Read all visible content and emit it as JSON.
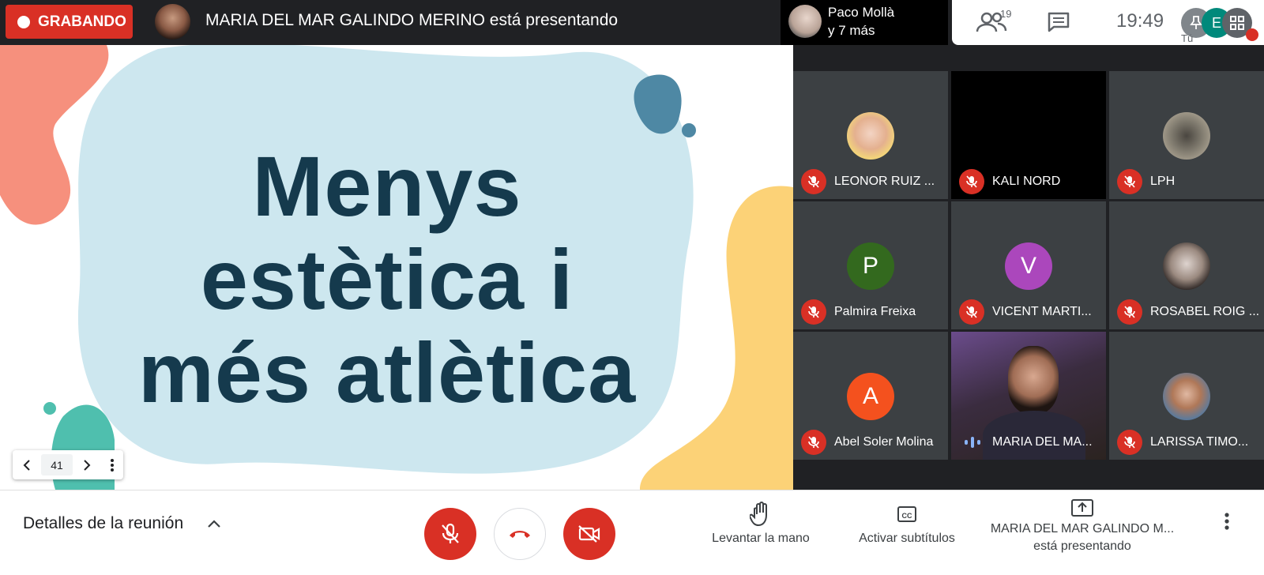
{
  "recording": {
    "label": "GRABANDO"
  },
  "presenter_bar": {
    "title": "MARIA DEL MAR GALINDO MERINO está presentando"
  },
  "others": {
    "line1": "Paco Mollà",
    "line2": "y 7 más"
  },
  "top_right": {
    "people_count": "19",
    "time": "19:49",
    "self_initial": "E",
    "self_label": "Tú"
  },
  "slide": {
    "lines": [
      "Menys",
      "estètica i",
      "més atlètica"
    ],
    "page": "41"
  },
  "participants": [
    {
      "name": "LEONOR RUIZ ...",
      "initial": "",
      "color": ""
    },
    {
      "name": "KALI NORD",
      "initial": "",
      "color": ""
    },
    {
      "name": "LPH",
      "initial": "",
      "color": ""
    },
    {
      "name": "Palmira Freixa",
      "initial": "P",
      "color": "#33691e"
    },
    {
      "name": "VICENT MARTI...",
      "initial": "V",
      "color": "#ab47bc"
    },
    {
      "name": "ROSABEL ROIG ...",
      "initial": "",
      "color": ""
    },
    {
      "name": "Abel Soler Molina",
      "initial": "A",
      "color": "#f4511e"
    },
    {
      "name": "MARIA DEL MA...",
      "initial": "",
      "color": ""
    },
    {
      "name": "LARISSA TIMO...",
      "initial": "",
      "color": ""
    }
  ],
  "bottom": {
    "details": "Detalles de la reunión",
    "raise_hand": "Levantar la mano",
    "captions": "Activar subtítulos",
    "presenting_name": "MARIA DEL MAR GALINDO M...",
    "presenting_status": "está presentando"
  },
  "colors": {
    "accent_red": "#d93025",
    "dark_bg": "#202124",
    "tile_bg": "#3c4043",
    "slide_text": "#153a4d"
  }
}
